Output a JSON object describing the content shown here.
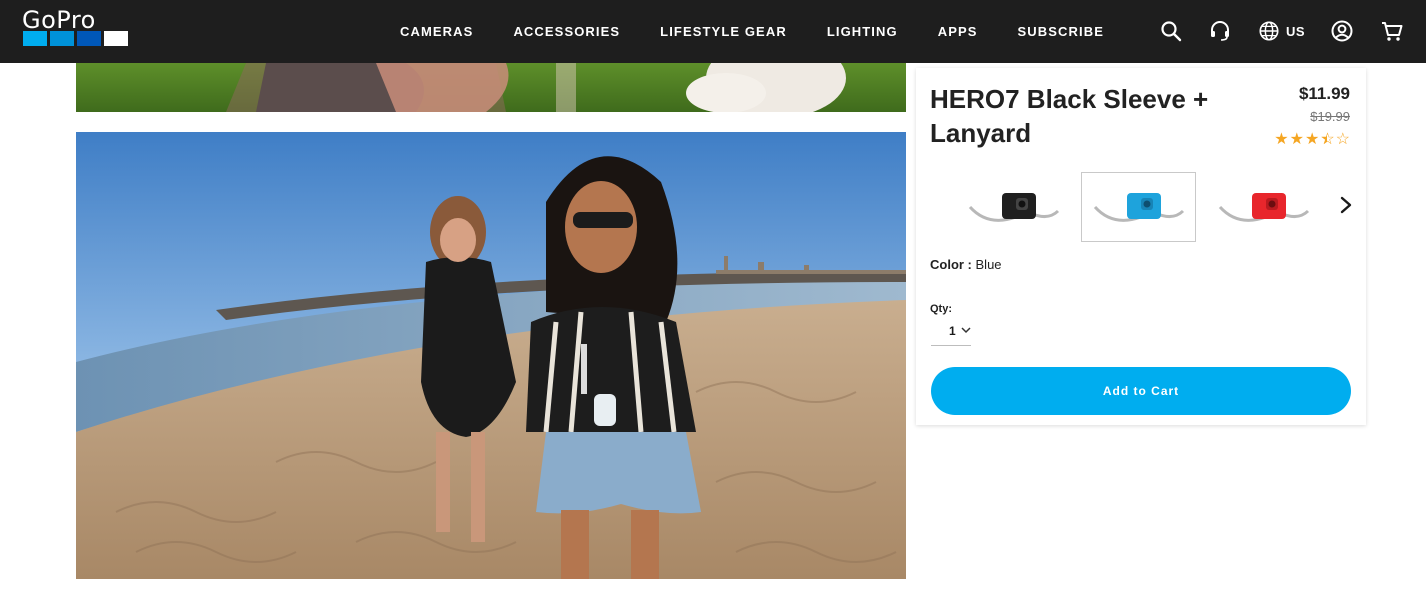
{
  "brand": {
    "logo_text": "GoPro",
    "logo_colors": [
      "#00adef",
      "#0092d9",
      "#0057b8",
      "#ffffff"
    ]
  },
  "nav": {
    "items": [
      "CAMERAS",
      "ACCESSORIES",
      "LIFESTYLE GEAR",
      "LIGHTING",
      "APPS",
      "SUBSCRIBE"
    ]
  },
  "header_icons": [
    "search-icon",
    "support-headset-icon",
    "globe-icon",
    "account-icon",
    "cart-icon"
  ],
  "region": {
    "label": "US"
  },
  "product": {
    "title": "HERO7 Black Sleeve + Lanyard",
    "price": "$11.99",
    "original_price": "$19.99",
    "rating": 3.5,
    "rating_max": 5,
    "color_label": "Color :",
    "color_value": "Blue",
    "variants": [
      {
        "name": "black",
        "color": "#1f1f1f",
        "selected": false
      },
      {
        "name": "blue",
        "color": "#1ea3dc",
        "selected": true
      },
      {
        "name": "red",
        "color": "#e8262c",
        "selected": false
      }
    ],
    "qty_label": "Qty:",
    "qty_value": "1",
    "add_to_cart_label": "Add to Cart"
  },
  "colors": {
    "header_bg": "#1e1e1e",
    "accent": "#00adef",
    "star": "#f5a623"
  }
}
